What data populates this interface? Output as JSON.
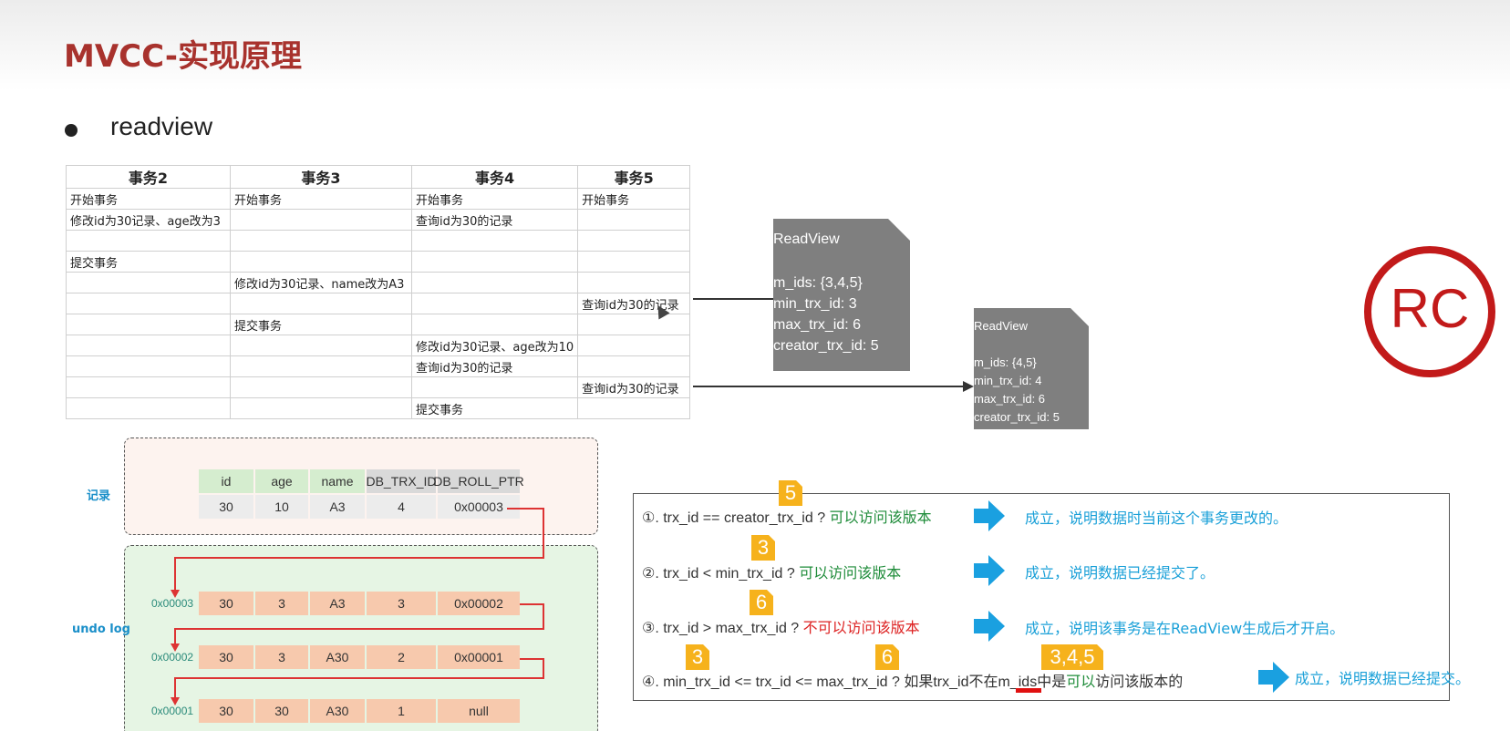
{
  "slide": {
    "title": "MVCC-实现原理",
    "bullet": "readview"
  },
  "txn_table": {
    "headers": [
      "事务2",
      "事务3",
      "事务4",
      "事务5"
    ],
    "rows": [
      [
        "开始事务",
        "开始事务",
        "开始事务",
        "开始事务"
      ],
      [
        "修改id为30记录、age改为3",
        "",
        "查询id为30的记录",
        ""
      ],
      [
        "",
        "",
        "",
        ""
      ],
      [
        "提交事务",
        "",
        "",
        ""
      ],
      [
        "",
        "修改id为30记录、name改为A3",
        "",
        ""
      ],
      [
        "",
        "",
        "",
        "查询id为30的记录"
      ],
      [
        "",
        "提交事务",
        "",
        ""
      ],
      [
        "",
        "",
        "修改id为30记录、age改为10",
        ""
      ],
      [
        "",
        "",
        "查询id为30的记录",
        ""
      ],
      [
        "",
        "",
        "",
        "查询id为30的记录"
      ],
      [
        "",
        "",
        "提交事务",
        ""
      ]
    ]
  },
  "readview_1": {
    "title": "ReadView",
    "m_ids": "m_ids: {3,4,5}",
    "min_trx_id": "min_trx_id: 3",
    "max_trx_id": "max_trx_id: 6",
    "creator_trx_id": "creator_trx_id: 5"
  },
  "readview_2": {
    "title": "ReadView",
    "m_ids": "m_ids: {4,5}",
    "min_trx_id": "min_trx_id: 4",
    "max_trx_id": "max_trx_id: 6",
    "creator_trx_id": "creator_trx_id: 5"
  },
  "badge": {
    "label": "RC",
    "color": "#c21a1a"
  },
  "record": {
    "label": "记录",
    "headers": [
      "id",
      "age",
      "name",
      "DB_TRX_ID",
      "DB_ROLL_PTR"
    ],
    "values": [
      "30",
      "10",
      "A3",
      "4",
      "0x00003"
    ]
  },
  "undo_log": {
    "label": "undo log",
    "entries": [
      {
        "addr": "0x00003",
        "values": [
          "30",
          "3",
          "A3",
          "3",
          "0x00002"
        ]
      },
      {
        "addr": "0x00002",
        "values": [
          "30",
          "3",
          "A30",
          "2",
          "0x00001"
        ]
      },
      {
        "addr": "0x00001",
        "values": [
          "30",
          "30",
          "A30",
          "1",
          "null"
        ]
      }
    ]
  },
  "rules": {
    "r1": {
      "prefix": "①. trx_id  == creator_trx_id ?",
      "verdict": "可以访问该版本",
      "tag": "5",
      "result": "成立，说明数据时当前这个事务更改的。"
    },
    "r2": {
      "prefix": "②. trx_id < min_trx_id ?",
      "verdict": "可以访问该版本",
      "tag": "3",
      "result": "成立，说明数据已经提交了。"
    },
    "r3": {
      "prefix": "③. trx_id > max_trx_id ?",
      "verdict": "不可以访问该版本",
      "tag": "6",
      "result": "成立，说明该事务是在ReadView生成后才开启。"
    },
    "r4": {
      "prefix": "④. min_trx_id <= trx_id <= max_trx_id ?  如果trx_id",
      "mid1": "不在",
      "mid2": "m_ids中是",
      "verdict": "可以",
      "suffix": "访问该版本的",
      "tag_a": "3",
      "tag_b": "6",
      "tag_c": "3,4,5",
      "result": "成立，说明数据已经提交。"
    }
  },
  "colors": {
    "title": "#a8322d",
    "accent_orange": "#f6b21c",
    "result_blue": "#1aa0d8",
    "ok_green": "#1f8c3a",
    "no_red": "#d22"
  }
}
